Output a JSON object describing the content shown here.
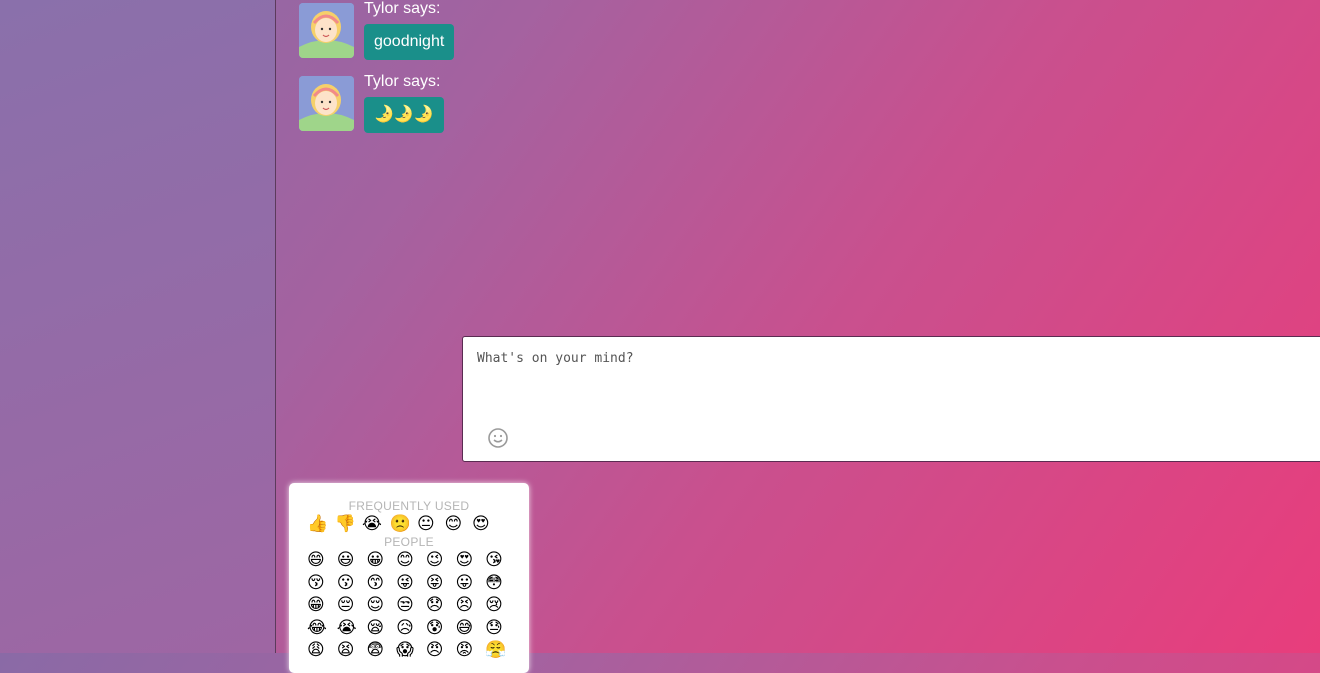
{
  "messages": [
    {
      "sender": "Tylor says:",
      "text": "goodnight"
    },
    {
      "sender": "Tylor says:",
      "text": "🌛🌛🌛"
    }
  ],
  "composer": {
    "placeholder": "What's on your mind?"
  },
  "emoji_picker": {
    "frequent_title": "FREQUENTLY USED",
    "frequent": [
      "👍",
      "👎",
      "😭",
      "🙁",
      "😐",
      "😊",
      "😍"
    ],
    "people_title": "PEOPLE",
    "people": [
      "😄",
      "😃",
      "😀",
      "😊",
      "😉",
      "😍",
      "😘",
      "😚",
      "😗",
      "😙",
      "😜",
      "😝",
      "😛",
      "😳",
      "😁",
      "😔",
      "😌",
      "😒",
      "😞",
      "😣",
      "😢",
      "😂",
      "😭",
      "😪",
      "😥",
      "😰",
      "😅",
      "😓",
      "😩",
      "😫",
      "😨",
      "😱",
      "😠",
      "😡",
      "😤"
    ]
  }
}
